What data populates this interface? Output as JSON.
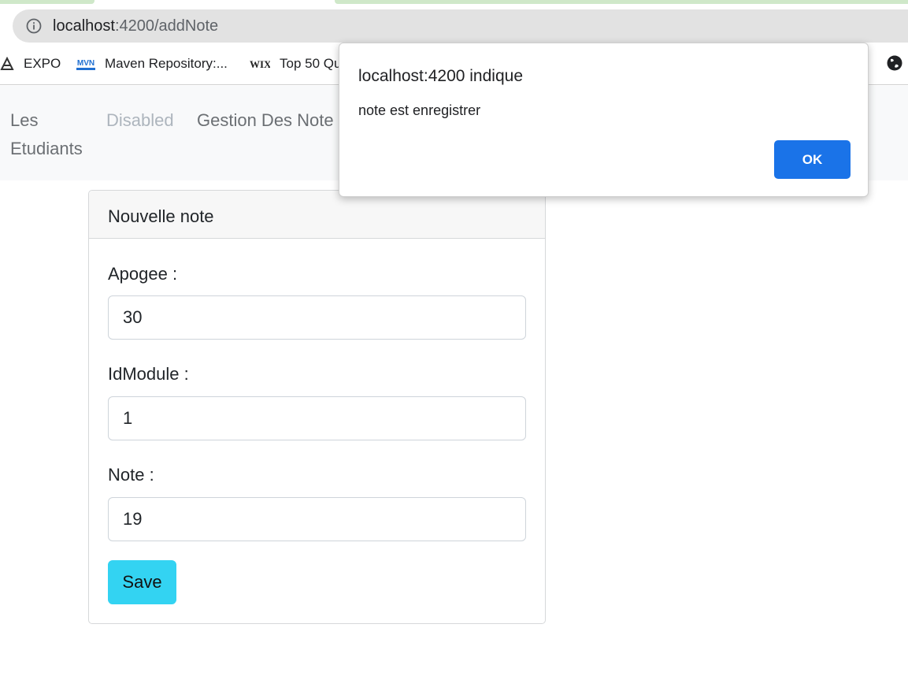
{
  "browser": {
    "url_host": "localhost",
    "url_path": ":4200/addNote",
    "bookmarks": [
      {
        "label": "EXPO",
        "icon": "expo-icon"
      },
      {
        "label": "Maven Repository:...",
        "icon": "maven-icon"
      },
      {
        "label": "Top 50 Qu",
        "icon": "wix-icon"
      }
    ],
    "maven_logo_text": "MVN",
    "wix_logo_text": "WIX"
  },
  "navbar": {
    "links": [
      {
        "label_line1": "Les",
        "label_line2": "Etudiants"
      },
      {
        "label": "Disabled"
      },
      {
        "label": "Gestion Des Note"
      }
    ]
  },
  "card": {
    "title": "Nouvelle note",
    "fields": [
      {
        "label": "Apogee :",
        "value": "30"
      },
      {
        "label": "IdModule :",
        "value": "1"
      },
      {
        "label": "Note :",
        "value": "19"
      }
    ],
    "save_label": "Save"
  },
  "dialog": {
    "title": "localhost:4200 indique",
    "message": "note est enregistrer",
    "ok_label": "OK"
  },
  "colors": {
    "accent_button": "#33d3f2",
    "dialog_ok": "#1a73e8",
    "navbar_bg": "#f8f9fa"
  }
}
